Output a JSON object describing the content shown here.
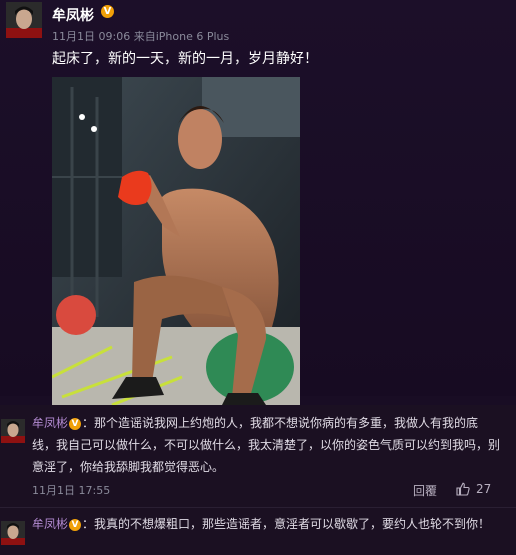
{
  "post": {
    "username": "牟凤彬",
    "verified_badge": "V",
    "timestamp": "11月1日 09:06",
    "source": "来自iPhone 6 Plus",
    "text": "起床了，新的一天，新的一月，岁月静好！"
  },
  "comments": [
    {
      "username": "牟凤彬",
      "verified_badge": "V",
      "text": "：那个造谣说我网上约炮的人，我都不想说你病的有多重，我做人有我的底线，我自己可以做什么，不可以做什么，我太清楚了，以你的姿色气质可以约到我吗，别意淫了，你给我舔脚我都觉得恶心。",
      "time": "11月1日 17:55",
      "reply_label": "回覆",
      "like_count": "27"
    },
    {
      "username": "牟凤彬",
      "verified_badge": "V",
      "text": "：我真的不想爆粗口，那些造谣者，意淫者可以歇歇了，要约人也轮不到你！"
    }
  ],
  "colors": {
    "background": "#190d24",
    "username_accent": "#b28ad1",
    "verified_badge": "#f1a008"
  },
  "icons": {
    "like": "thumbs-up-icon"
  }
}
